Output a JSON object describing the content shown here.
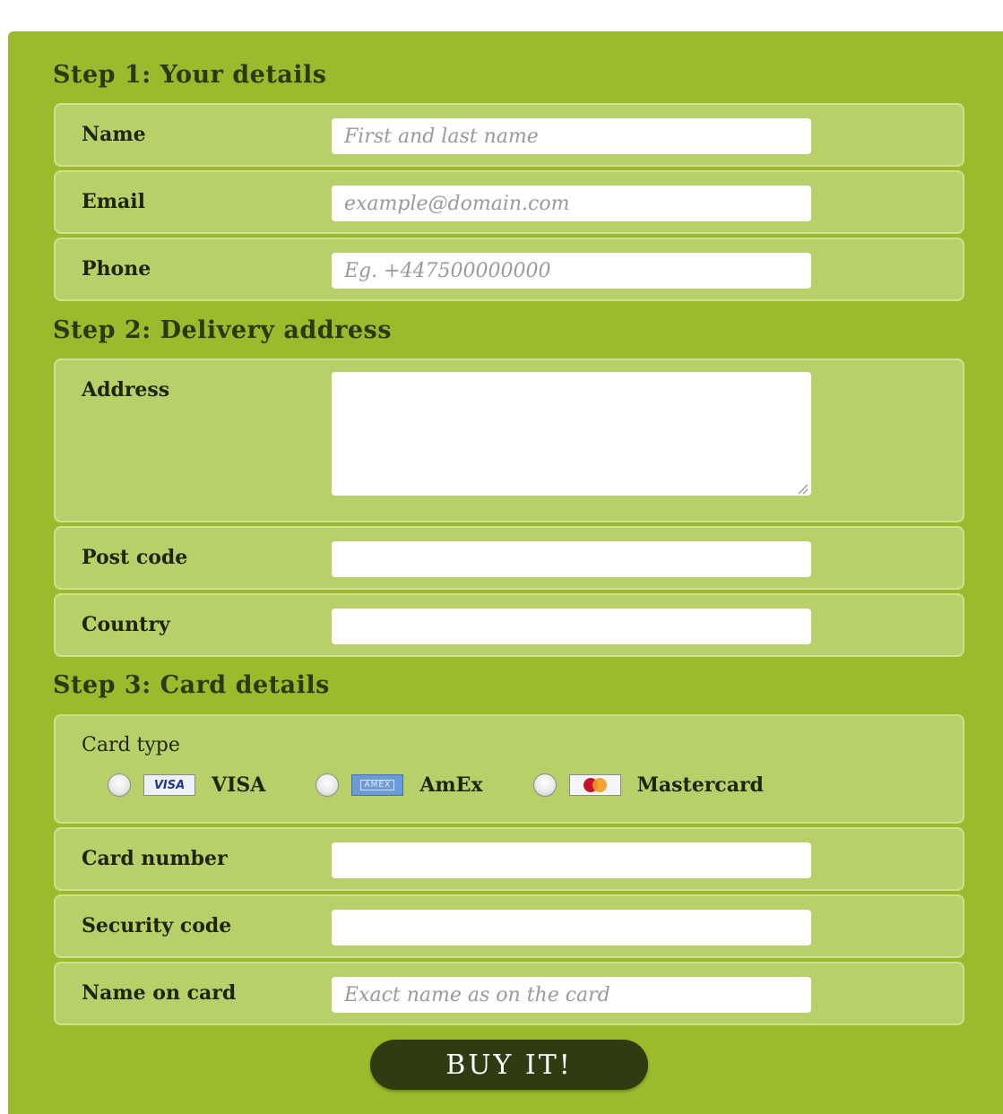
{
  "steps": [
    {
      "title": "Step 1: Your details"
    },
    {
      "title": "Step 2: Delivery address"
    },
    {
      "title": "Step 3: Card details"
    }
  ],
  "fields": {
    "name": {
      "label": "Name",
      "placeholder": "First and last name",
      "value": ""
    },
    "email": {
      "label": "Email",
      "placeholder": "example@domain.com",
      "value": ""
    },
    "phone": {
      "label": "Phone",
      "placeholder": "Eg. +447500000000",
      "value": ""
    },
    "address": {
      "label": "Address",
      "placeholder": "",
      "value": ""
    },
    "postcode": {
      "label": "Post code",
      "placeholder": "",
      "value": ""
    },
    "country": {
      "label": "Country",
      "placeholder": "",
      "value": ""
    },
    "card_number": {
      "label": "Card number",
      "placeholder": "",
      "value": ""
    },
    "security_code": {
      "label": "Security code",
      "placeholder": "",
      "value": ""
    },
    "name_on_card": {
      "label": "Name on card",
      "placeholder": "Exact name as on the card",
      "value": ""
    }
  },
  "card_type": {
    "label": "Card type",
    "options": [
      {
        "name": "VISA",
        "logo_text": "VISA",
        "icon": "visa-logo-icon"
      },
      {
        "name": "AmEx",
        "logo_text": "AMEX",
        "icon": "amex-logo-icon"
      },
      {
        "name": "Mastercard",
        "logo_text": "",
        "icon": "mastercard-logo-icon"
      }
    ]
  },
  "submit": {
    "label": "BUY IT!"
  },
  "colors": {
    "panel": "#9cbb2c",
    "row_bg": "#b8d06a",
    "row_border": "#cfe18f",
    "button": "#2f3b10"
  }
}
